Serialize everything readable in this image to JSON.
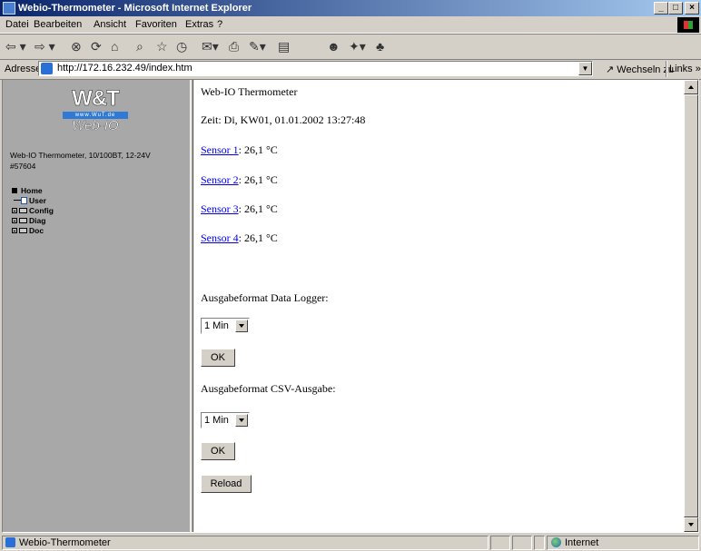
{
  "window": {
    "title": "Webio-Thermometer - Microsoft Internet Explorer"
  },
  "menu": [
    "Datei",
    "Bearbeiten",
    "Ansicht",
    "Favoriten",
    "Extras",
    "?"
  ],
  "address": {
    "label": "Adresse",
    "url": "http://172.16.232.49/index.htm",
    "go_label": "Wechseln zu",
    "links_label": "Links"
  },
  "sidebar": {
    "logo_main": "W&T",
    "logo_www": "www.WuT.de",
    "logo_sub": "Web-IO",
    "device_line1": "Web-IO Thermometer, 10/100BT, 12-24V",
    "device_line2": "#57604",
    "tree": {
      "home": "Home",
      "user": "User",
      "config": "Config",
      "diag": "Diag",
      "doc": "Doc"
    }
  },
  "main": {
    "heading": "Web-IO Thermometer",
    "time": "Zeit: Di, KW01, 01.01.2002 13:27:48",
    "sensors": [
      {
        "link": "Sensor 1",
        "value": ": 26,1 °C"
      },
      {
        "link": "Sensor 2",
        "value": ": 26,1 °C"
      },
      {
        "link": "Sensor 3",
        "value": ": 26,1 °C"
      },
      {
        "link": "Sensor 4",
        "value": ": 26,1 °C"
      }
    ],
    "logger_label": "Ausgabeformat Data Logger:",
    "logger_select": "1 Min",
    "logger_ok": "OK",
    "csv_label": "Ausgabeformat CSV-Ausgabe:",
    "csv_select": "1 Min",
    "csv_ok": "OK",
    "reload": "Reload"
  },
  "status": {
    "text": "Webio-Thermometer",
    "zone": "Internet"
  }
}
